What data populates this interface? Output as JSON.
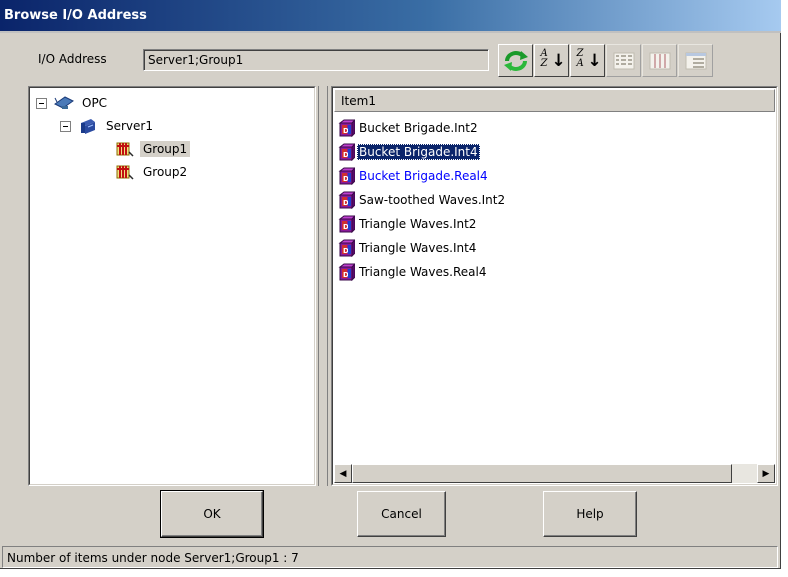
{
  "window": {
    "title": "Browse I/O Address"
  },
  "address": {
    "label": "I/O Address",
    "value": "Server1;Group1"
  },
  "toolbar": {
    "buttons": [
      {
        "icon": "refresh-icon"
      },
      {
        "icon": "sort-ascending-icon",
        "top": "A",
        "bottom": "Z"
      },
      {
        "icon": "sort-descending-icon",
        "top": "Z",
        "bottom": "A"
      },
      {
        "icon": "list-view-icon"
      },
      {
        "icon": "details-view-icon"
      },
      {
        "icon": "report-view-icon"
      }
    ]
  },
  "tree": {
    "root": {
      "label": "OPC"
    },
    "server": {
      "label": "Server1"
    },
    "groups": [
      {
        "label": "Group1",
        "selected": true
      },
      {
        "label": "Group2",
        "selected": false
      }
    ]
  },
  "list": {
    "column_header": "Item1",
    "items": [
      {
        "label": "Bucket Brigade.Int2"
      },
      {
        "label": "Bucket Brigade.Int4",
        "selected": true
      },
      {
        "label": "Bucket Brigade.Real4",
        "highlight": true
      },
      {
        "label": "Saw-toothed Waves.Int2"
      },
      {
        "label": "Triangle Waves.Int2"
      },
      {
        "label": "Triangle Waves.Int4"
      },
      {
        "label": "Triangle Waves.Real4"
      }
    ]
  },
  "buttons": {
    "ok": "OK",
    "cancel": "Cancel",
    "help": "Help"
  },
  "status": {
    "text": "Number of items under node  Server1;Group1 : 7"
  },
  "colors": {
    "title_start": "#0a246a",
    "title_end": "#a6caf0",
    "selection": "#0a246a",
    "link_blue": "#0000ff",
    "face": "#d4d0c8"
  }
}
